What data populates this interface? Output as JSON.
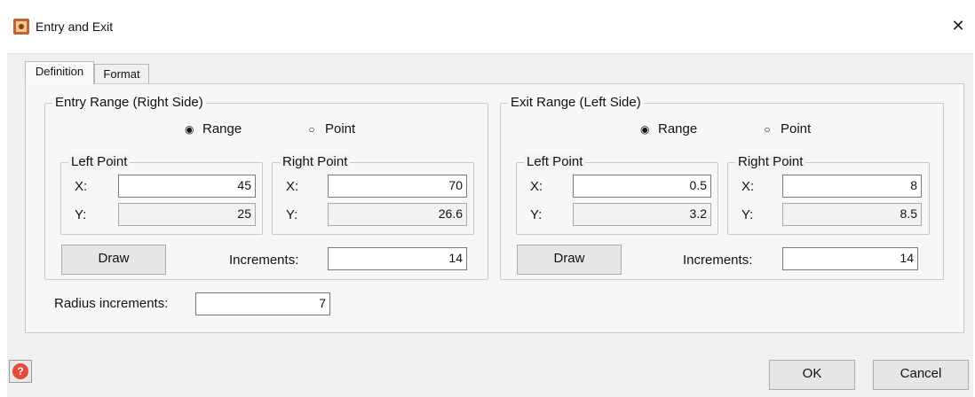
{
  "window": {
    "title": "Entry and Exit",
    "close_glyph": "✕"
  },
  "tabs": [
    {
      "label": "Definition",
      "active": true
    },
    {
      "label": "Format",
      "active": false
    }
  ],
  "entry": {
    "legend": "Entry Range (Right Side)",
    "radio_range": "Range",
    "radio_point": "Point",
    "selected": "Range",
    "left_point": {
      "legend": "Left Point",
      "x_label": "X:",
      "x": "45",
      "y_label": "Y:",
      "y": "25"
    },
    "right_point": {
      "legend": "Right Point",
      "x_label": "X:",
      "x": "70",
      "y_label": "Y:",
      "y": "26.6"
    },
    "draw_label": "Draw",
    "increments_label": "Increments:",
    "increments": "14"
  },
  "exit": {
    "legend": "Exit Range (Left Side)",
    "radio_range": "Range",
    "radio_point": "Point",
    "selected": "Range",
    "left_point": {
      "legend": "Left Point",
      "x_label": "X:",
      "x": "0.5",
      "y_label": "Y:",
      "y": "3.2"
    },
    "right_point": {
      "legend": "Right Point",
      "x_label": "X:",
      "x": "8",
      "y_label": "Y:",
      "y": "8.5"
    },
    "draw_label": "Draw",
    "increments_label": "Increments:",
    "increments": "14"
  },
  "radius": {
    "label": "Radius increments:",
    "value": "7"
  },
  "footer": {
    "ok_label": "OK",
    "cancel_label": "Cancel",
    "help_glyph": "?"
  },
  "colors": {
    "help_red": "#e8493a",
    "dialog_bg": "#f0f0f0"
  },
  "icons": {
    "app": "app-window-icon",
    "help": "help-icon",
    "close": "close-icon"
  }
}
